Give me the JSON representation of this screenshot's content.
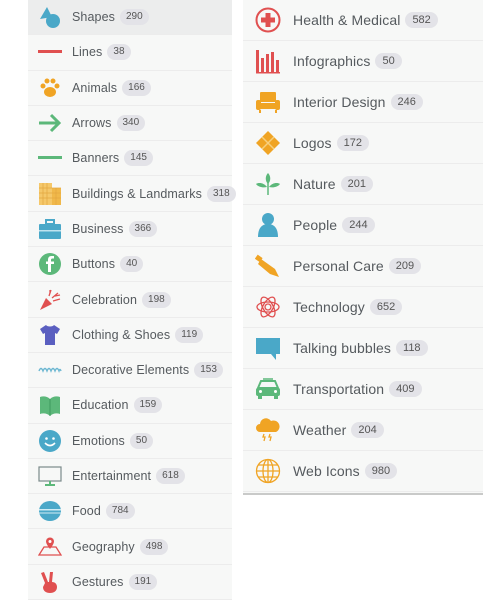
{
  "left_column": {
    "items": [
      {
        "label": "Shapes",
        "count": "290",
        "icon": "shapes-icon",
        "active": true
      },
      {
        "label": "Lines",
        "count": "38",
        "icon": "line-icon"
      },
      {
        "label": "Animals",
        "count": "166",
        "icon": "paw-icon"
      },
      {
        "label": "Arrows",
        "count": "340",
        "icon": "arrow-right-icon"
      },
      {
        "label": "Banners",
        "count": "145",
        "icon": "banner-icon"
      },
      {
        "label": "Buildings & Landmarks",
        "count": "318",
        "icon": "building-icon"
      },
      {
        "label": "Business",
        "count": "366",
        "icon": "briefcase-icon"
      },
      {
        "label": "Buttons",
        "count": "40",
        "icon": "facebook-button-icon"
      },
      {
        "label": "Celebration",
        "count": "198",
        "icon": "party-popper-icon"
      },
      {
        "label": "Clothing & Shoes",
        "count": "119",
        "icon": "tshirt-icon"
      },
      {
        "label": "Decorative Elements",
        "count": "153",
        "icon": "decorative-wave-icon"
      },
      {
        "label": "Education",
        "count": "159",
        "icon": "open-book-icon"
      },
      {
        "label": "Emotions",
        "count": "50",
        "icon": "smiley-icon"
      },
      {
        "label": "Entertainment",
        "count": "618",
        "icon": "monitor-icon"
      },
      {
        "label": "Food",
        "count": "784",
        "icon": "macaron-icon"
      },
      {
        "label": "Geography",
        "count": "498",
        "icon": "map-pin-icon"
      },
      {
        "label": "Gestures",
        "count": "191",
        "icon": "peace-hand-icon"
      }
    ]
  },
  "right_column": {
    "items": [
      {
        "label": "Health & Medical",
        "count": "582",
        "icon": "medical-cross-icon"
      },
      {
        "label": "Infographics",
        "count": "50",
        "icon": "bar-chart-icon"
      },
      {
        "label": "Interior Design",
        "count": "246",
        "icon": "armchair-icon"
      },
      {
        "label": "Logos",
        "count": "172",
        "icon": "diamond-logo-icon"
      },
      {
        "label": "Nature",
        "count": "201",
        "icon": "plant-icon"
      },
      {
        "label": "People",
        "count": "244",
        "icon": "person-icon"
      },
      {
        "label": "Personal Care",
        "count": "209",
        "icon": "tube-icon"
      },
      {
        "label": "Technology",
        "count": "652",
        "icon": "atom-icon"
      },
      {
        "label": "Talking bubbles",
        "count": "118",
        "icon": "speech-bubble-icon"
      },
      {
        "label": "Transportation",
        "count": "409",
        "icon": "car-icon"
      },
      {
        "label": "Weather",
        "count": "204",
        "icon": "storm-cloud-icon"
      },
      {
        "label": "Web Icons",
        "count": "980",
        "icon": "globe-icon"
      }
    ]
  },
  "colors": {
    "blue": "#4aa8c8",
    "red": "#e05050",
    "orange": "#f0a424",
    "green": "#5cb87a",
    "purple": "#5a5fc0",
    "badge_bg": "#e3e3e8",
    "text": "#555a5e"
  }
}
